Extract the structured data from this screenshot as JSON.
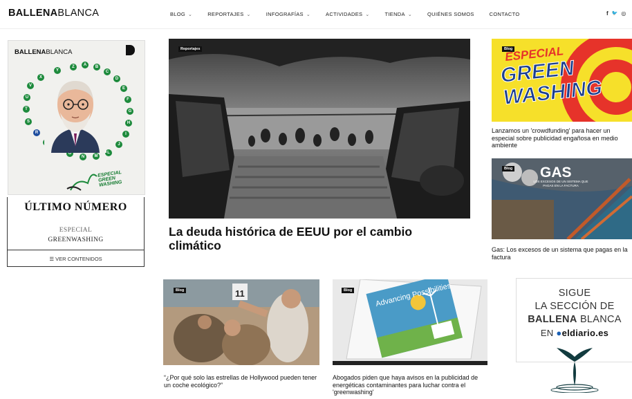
{
  "header": {
    "logo_bold": "BALLENA",
    "logo_light": "BLANCA",
    "nav": [
      {
        "label": "BLOG",
        "dropdown": true
      },
      {
        "label": "REPORTAJES",
        "dropdown": true
      },
      {
        "label": "INFOGRAFÍAS",
        "dropdown": true
      },
      {
        "label": "ACTIVIDADES",
        "dropdown": true
      },
      {
        "label": "TIENDA",
        "dropdown": true
      },
      {
        "label": "QUIÉNES SOMOS",
        "dropdown": false
      },
      {
        "label": "CONTACTO",
        "dropdown": false
      }
    ],
    "social": [
      "f",
      "🐦",
      "◎"
    ]
  },
  "magazine": {
    "cover_title_bold": "BALLENA",
    "cover_title_light": "BLANCA",
    "cover_letters": [
      "Z",
      "A",
      "B",
      "C",
      "D",
      "E",
      "F",
      "G",
      "H",
      "I",
      "J",
      "L",
      "M",
      "N",
      "Ñ",
      "O",
      "P",
      "Q",
      "R",
      "S",
      "T",
      "U",
      "V",
      "X",
      "Y"
    ],
    "cover_special": "ESPECIAL GREEN WASHING",
    "heading": "ÚLTIMO NÚMERO",
    "line1": "ESPECIAL",
    "line2": "GREENWASHING",
    "button": "VER CONTENIDOS",
    "button_icon": "list-icon"
  },
  "featured": {
    "tag": "Reportajes",
    "title": "La deuda histórica de EEUU por el cambio climático"
  },
  "side_articles": [
    {
      "tag": "Blog",
      "image_text_1": "ESPECIAL",
      "image_text_2": "GREEN",
      "image_text_3": "WASHING",
      "caption": "Lanzamos un 'crowdfunding' para hacer un especial sobre publicidad engañosa en medio ambiente"
    },
    {
      "tag": "Blog",
      "image_text_1": "GAS",
      "image_text_2": "LOS EXCESOS DE UN SISTEMA QUE PAGAS EN LA FACTURA",
      "caption": "Gas: Los excesos de un sistema que pagas en la factura"
    }
  ],
  "bottom_articles": [
    {
      "tag": "Blog",
      "caption": "“¿Por qué solo las estrellas de Hollywood pueden tener un coche ecológico?”"
    },
    {
      "tag": "Blog",
      "image_text": "Advancing Possibilities",
      "caption": "Abogados piden que haya avisos en la publicidad de energéticas contaminantes para luchar contra el 'greenwashing'"
    }
  ],
  "promo": {
    "line1": "SIGUE",
    "line2": "LA SECCIÓN DE",
    "line3_bold": "BALLENA",
    "line3_light": "BLANCA",
    "line4_prefix": "EN",
    "line4_brand": "eldiario.es"
  },
  "colors": {
    "accent_green": "#1d8a3c",
    "blog_tag": "#111111",
    "gw_yellow": "#f6e02a",
    "gw_red": "#e6332a",
    "gw_blue": "#1b3f8f"
  }
}
